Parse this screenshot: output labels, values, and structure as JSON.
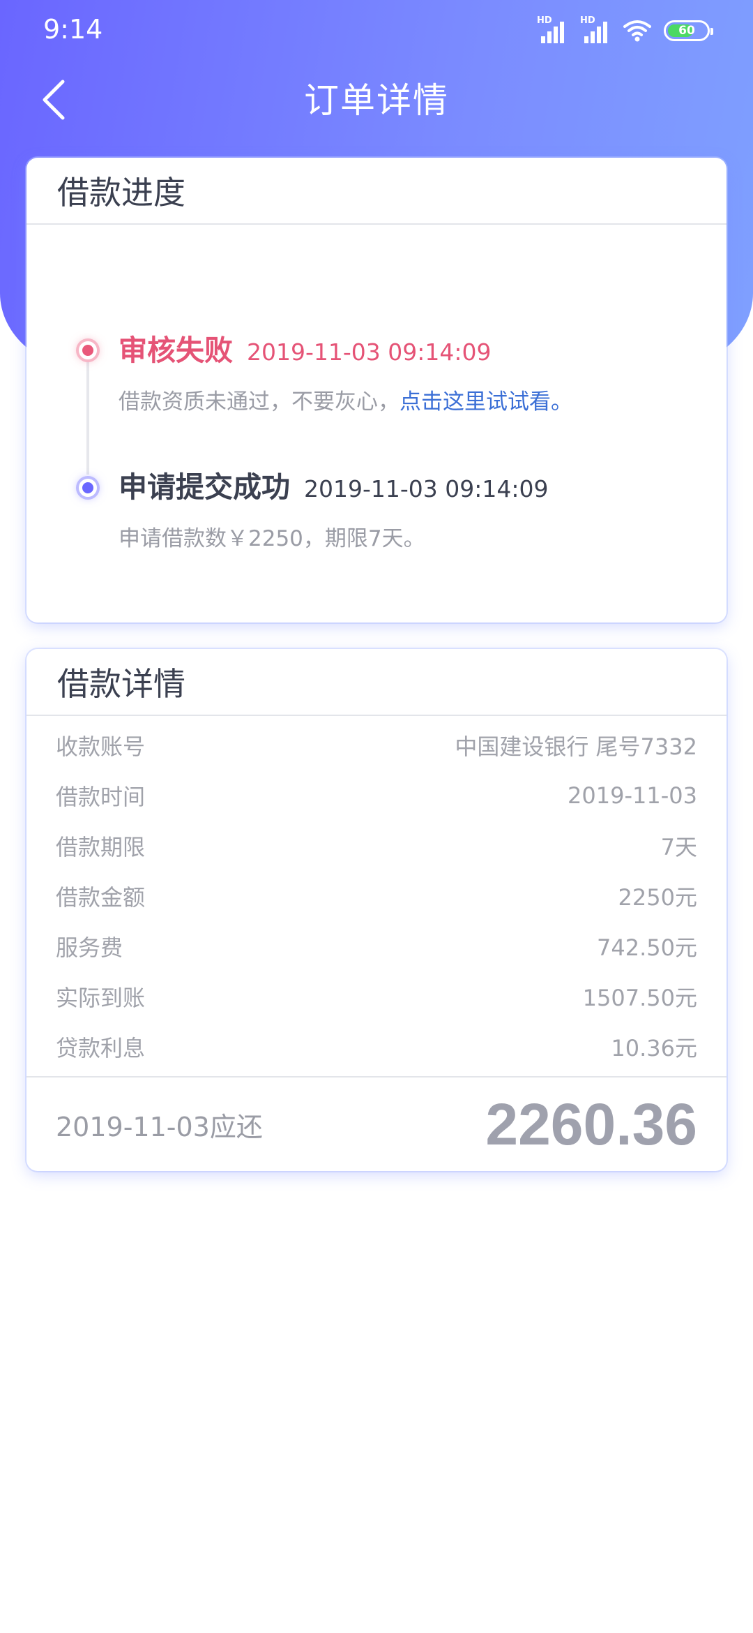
{
  "status_bar": {
    "time": "9:14",
    "battery": "60",
    "signal_label": "HD"
  },
  "nav": {
    "title": "订单详情"
  },
  "progress": {
    "title": "借款进度",
    "items": [
      {
        "status": "审核失败",
        "time": "2019-11-03 09:14:09",
        "desc": "借款资质未通过，不要灰心，",
        "link": "点击这里试试看。"
      },
      {
        "status": "申请提交成功",
        "time": "2019-11-03 09:14:09",
        "desc": "申请借款数￥2250，期限7天。"
      }
    ]
  },
  "detail": {
    "title": "借款详情",
    "rows": [
      {
        "label": "收款账号",
        "value": "中国建设银行 尾号7332"
      },
      {
        "label": "借款时间",
        "value": "2019-11-03"
      },
      {
        "label": "借款期限",
        "value": "7天"
      },
      {
        "label": "借款金额",
        "value": "2250元"
      },
      {
        "label": "服务费",
        "value": "742.50元"
      },
      {
        "label": "实际到账",
        "value": "1507.50元"
      },
      {
        "label": "贷款利息",
        "value": "10.36元"
      }
    ],
    "total_label": "2019-11-03应还",
    "total_amount": "2260.36"
  },
  "colors": {
    "header_start": "#6a66ff",
    "header_end": "#7fa0ff",
    "fail": "#e55376",
    "link": "#3b6fd6"
  }
}
